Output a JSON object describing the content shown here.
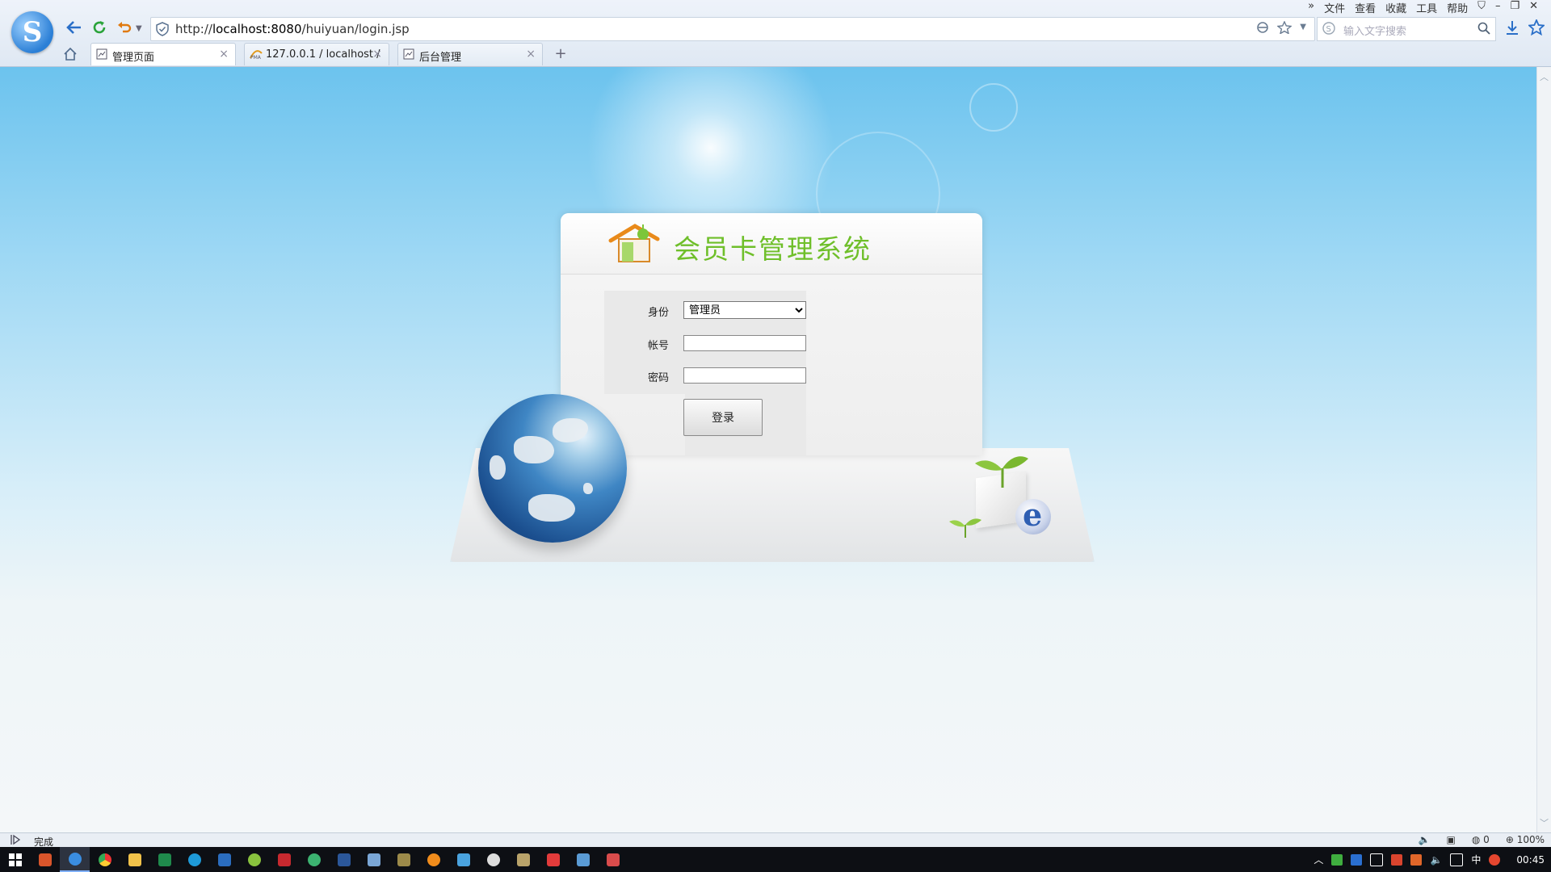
{
  "browser": {
    "url_prefix": "http://",
    "url_host": "localhost:8080",
    "url_path": "/huiyuan/login.jsp",
    "search_placeholder": "输入文字搜索",
    "menus": [
      "»",
      "文件",
      "查看",
      "收藏",
      "工具",
      "帮助"
    ],
    "tabs": [
      {
        "label": "管理页面",
        "active": true
      },
      {
        "label": "127.0.0.1 / localhost /",
        "active": false
      },
      {
        "label": "后台管理",
        "active": false
      }
    ],
    "new_tab": "+"
  },
  "login": {
    "title": "会员卡管理系统",
    "role_label": "身份",
    "role_value": "管理员",
    "role_options": [
      "管理员"
    ],
    "account_label": "帐号",
    "password_label": "密码",
    "submit_label": "登录"
  },
  "status": {
    "text": "完成",
    "count": "0",
    "zoom": "100%"
  },
  "tray": {
    "ime": "中",
    "time": "00:45"
  },
  "colors": {
    "title_green": "#6fbf2a",
    "sky_top": "#6cc3ee",
    "taskbar": "#0d0f14"
  }
}
